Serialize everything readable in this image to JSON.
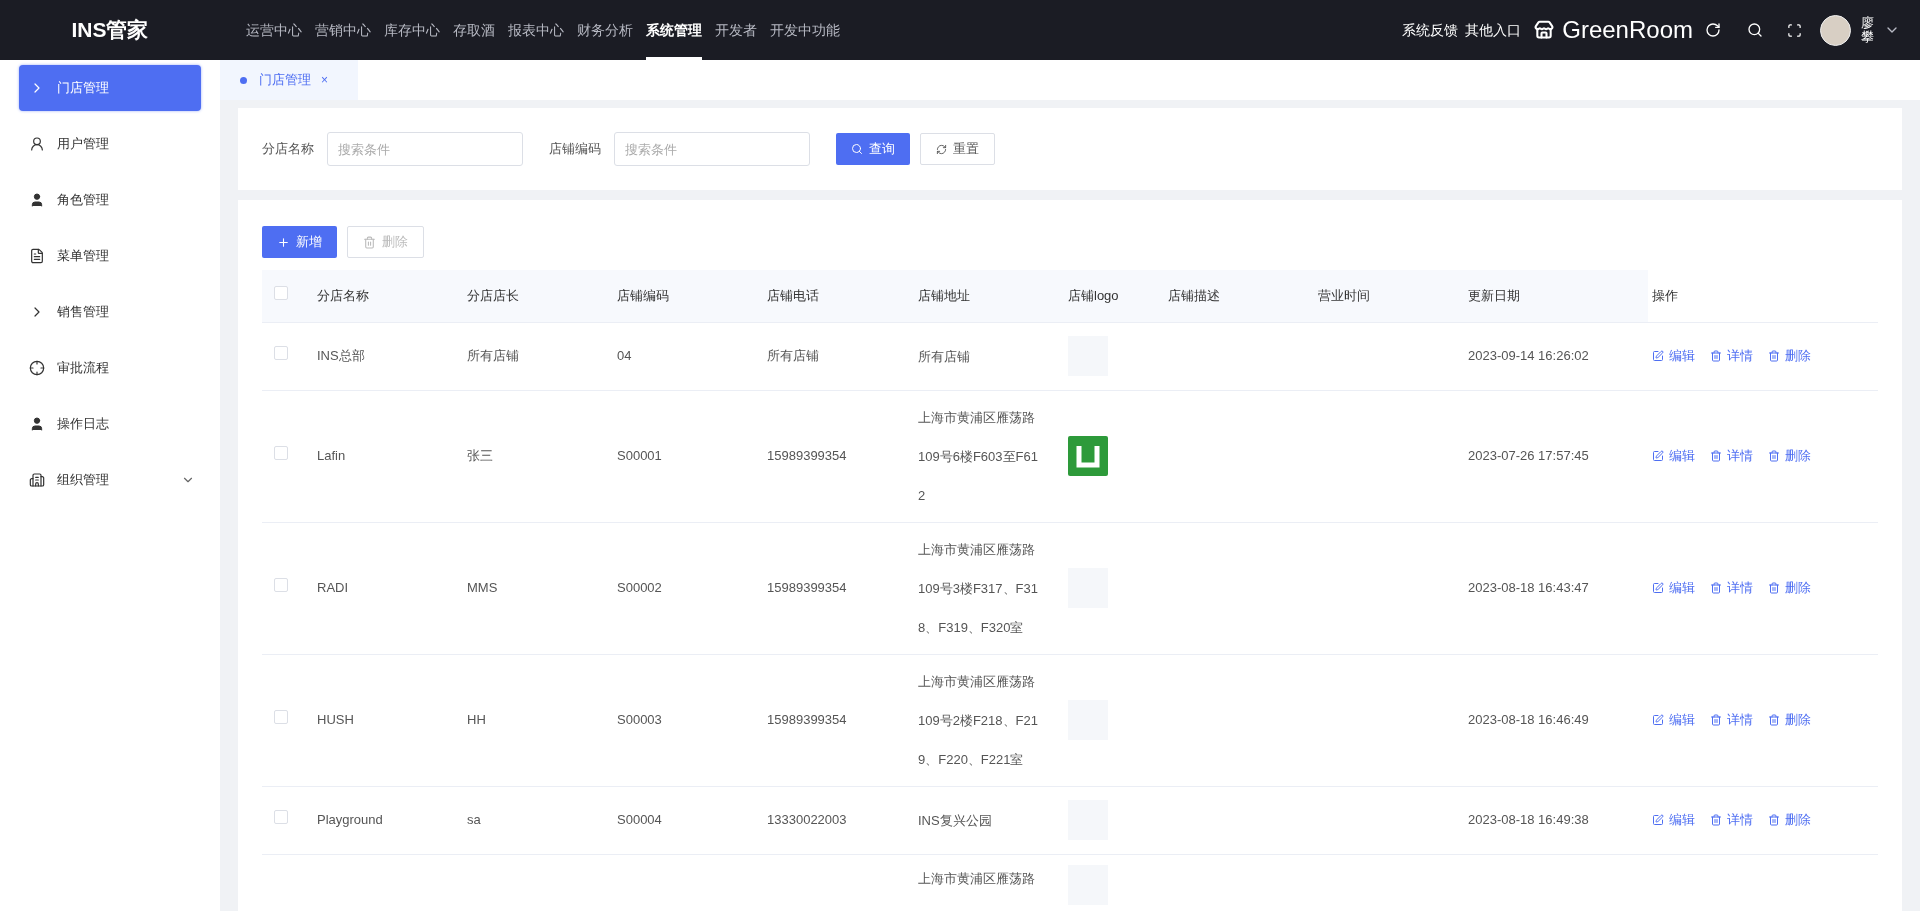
{
  "brand": "INS管家",
  "nav": [
    {
      "label": "运营中心",
      "selected": false
    },
    {
      "label": "营销中心",
      "selected": false
    },
    {
      "label": "库存中心",
      "selected": false
    },
    {
      "label": "存取酒",
      "selected": false
    },
    {
      "label": "报表中心",
      "selected": false
    },
    {
      "label": "财务分析",
      "selected": false
    },
    {
      "label": "系统管理",
      "selected": true
    },
    {
      "label": "开发者",
      "selected": false
    },
    {
      "label": "开发中功能",
      "selected": false
    }
  ],
  "header_links": [
    "系统反馈",
    "其他入口"
  ],
  "store_name": "GreenRoom",
  "user": {
    "name": "廖攀"
  },
  "sidebar": {
    "items": [
      {
        "label": "门店管理",
        "selected": true,
        "kind": "link"
      },
      {
        "label": "用户管理",
        "selected": false,
        "kind": "link"
      },
      {
        "label": "角色管理",
        "selected": false,
        "kind": "link"
      },
      {
        "label": "菜单管理",
        "selected": false,
        "kind": "link"
      },
      {
        "label": "销售管理",
        "selected": false,
        "kind": "link"
      },
      {
        "label": "审批流程",
        "selected": false,
        "kind": "link"
      },
      {
        "label": "操作日志",
        "selected": false,
        "kind": "link"
      },
      {
        "label": "组织管理",
        "selected": false,
        "kind": "group"
      }
    ]
  },
  "tabs": [
    {
      "label": "门店管理",
      "selected": true,
      "close": "×"
    }
  ],
  "search": {
    "fields": [
      {
        "label": "分店名称",
        "placeholder": "搜索条件"
      },
      {
        "label": "店铺编码",
        "placeholder": "搜索条件"
      }
    ],
    "buttons": [
      {
        "label": "查询",
        "kind": "primary"
      },
      {
        "label": "重置",
        "kind": "default"
      }
    ]
  },
  "toolbar": [
    {
      "label": "新增",
      "kind": "add",
      "disabled": false
    },
    {
      "label": "删除",
      "kind": "delete",
      "disabled": true
    }
  ],
  "table": {
    "header_checked": false,
    "columns": [
      "分店名称",
      "分店店长",
      "店铺编码",
      "店铺电话",
      "店铺地址",
      "店铺logo",
      "店铺描述",
      "营业时间",
      "更新日期",
      "操作"
    ],
    "rows": [
      {
        "checked": false,
        "name": "INS总部",
        "manager": "所有店铺",
        "code": "04",
        "phone": "所有店铺",
        "address": "所有店铺",
        "logo_loaded": false,
        "updated": "2023-09-14 16:26:02",
        "actions": [
          "编辑",
          "详情",
          "删除"
        ]
      },
      {
        "checked": false,
        "name": "Lafin",
        "manager": "张三",
        "code": "S00001",
        "phone": "15989399354",
        "address": "上海市黄浦区雁荡路109号6楼F603至F612",
        "logo_loaded": true,
        "updated": "2023-07-26 17:57:45",
        "actions": [
          "编辑",
          "详情",
          "删除"
        ]
      },
      {
        "checked": false,
        "name": "RADI",
        "manager": "MMS",
        "code": "S00002",
        "phone": "15989399354",
        "address": "上海市黄浦区雁荡路109号3楼F317、F318、F319、F320室",
        "logo_loaded": false,
        "updated": "2023-08-18 16:43:47",
        "actions": [
          "编辑",
          "详情",
          "删除"
        ]
      },
      {
        "checked": false,
        "name": "HUSH",
        "manager": "HH",
        "code": "S00003",
        "phone": "15989399354",
        "address": "上海市黄浦区雁荡路109号2楼F218、F219、F220、F221室",
        "logo_loaded": false,
        "updated": "2023-08-18 16:46:49",
        "actions": [
          "编辑",
          "详情",
          "删除"
        ]
      },
      {
        "checked": false,
        "name": "Playground",
        "manager": "sa",
        "code": "S00004",
        "phone": "13330022003",
        "address": "INS复兴公园",
        "logo_loaded": false,
        "updated": "2023-08-18 16:49:38",
        "actions": [
          "编辑",
          "详情",
          "删除"
        ]
      },
      {
        "address": "上海市黄浦区雁荡路",
        "logo_loaded": false
      }
    ]
  }
}
